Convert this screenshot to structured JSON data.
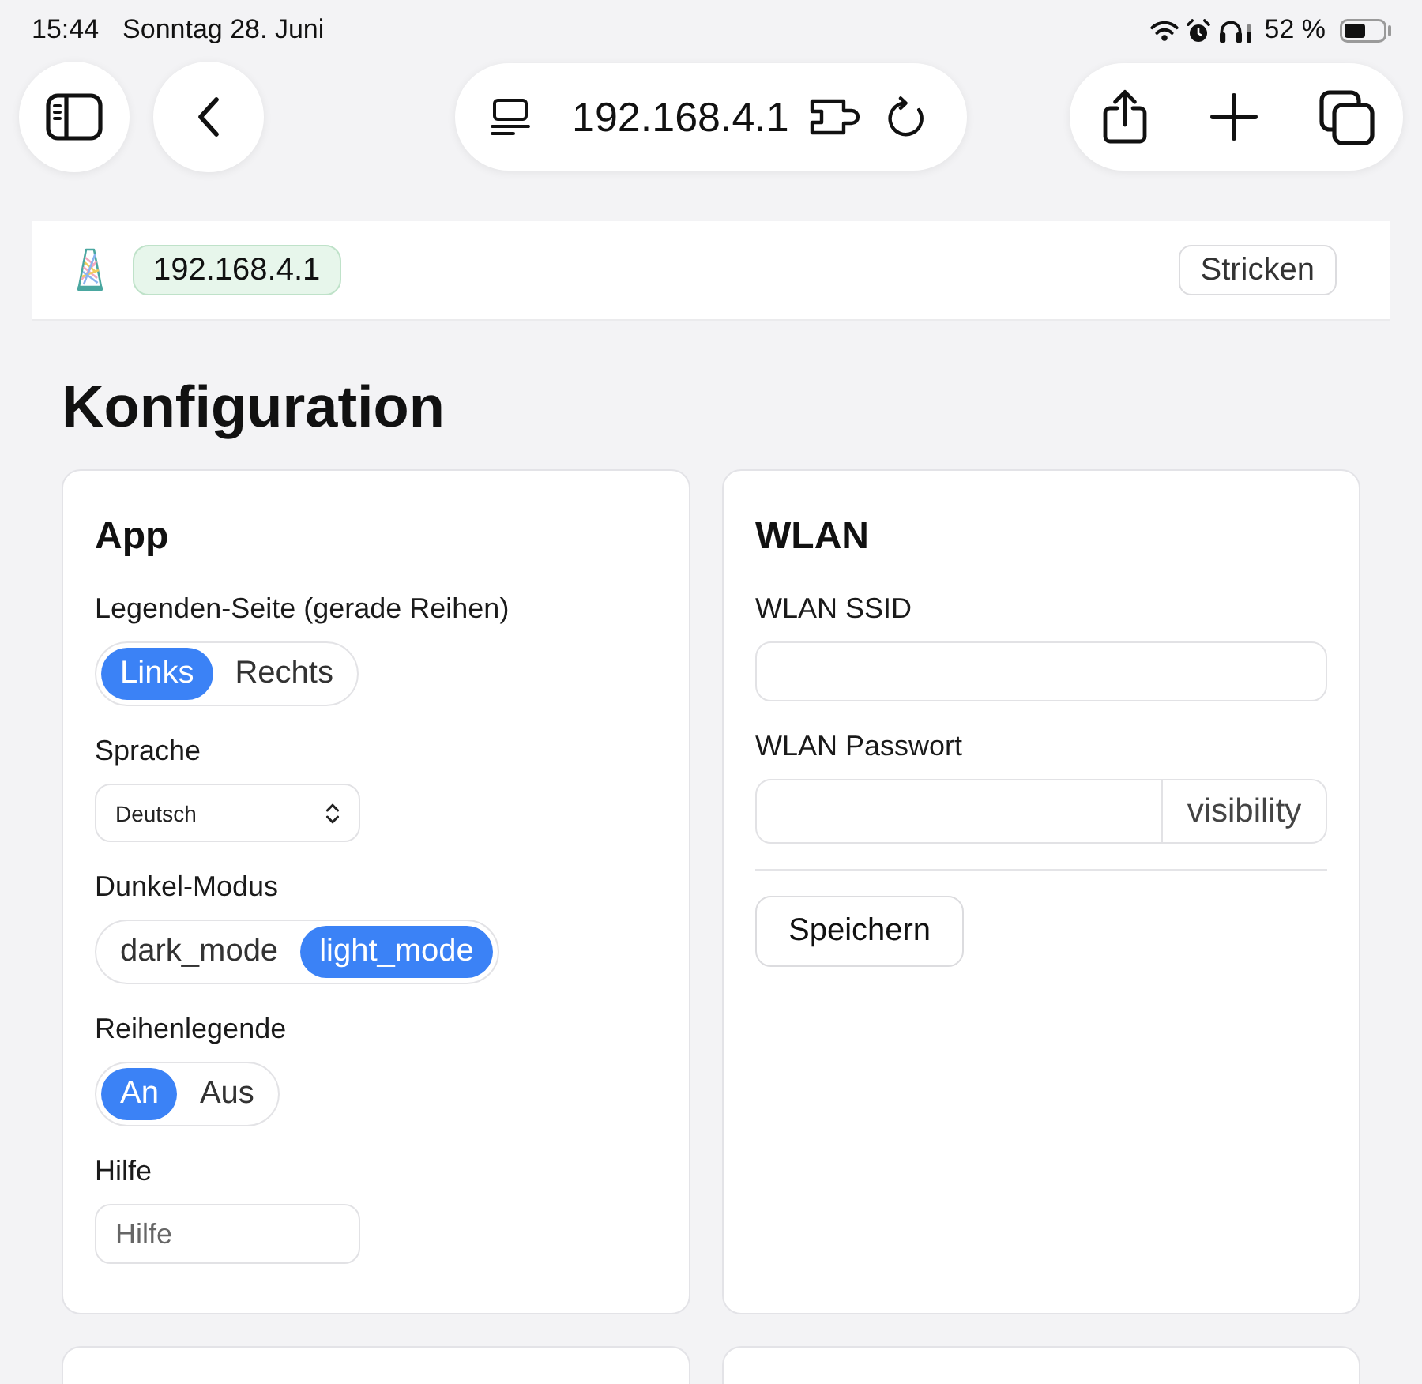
{
  "status_bar": {
    "time": "15:44",
    "date": "Sonntag 28. Juni",
    "battery": "52 %"
  },
  "browser": {
    "address": "192.168.4.1"
  },
  "app_bar": {
    "host": "192.168.4.1",
    "action": "Stricken"
  },
  "title": "Konfiguration",
  "cards": [
    {
      "kind": "form",
      "title": "App",
      "fields": [
        {
          "kind": "segmented",
          "label": "Legenden-Seite (gerade Reihen)",
          "options": [
            {
              "label": "Links",
              "selected": true
            },
            {
              "label": "Rechts",
              "selected": false
            }
          ]
        },
        {
          "kind": "select",
          "label": "Sprache",
          "value": "Deutsch"
        },
        {
          "kind": "segmented",
          "label": "Dunkel-Modus",
          "options": [
            {
              "label": "dark_mode",
              "selected": false
            },
            {
              "label": "light_mode",
              "selected": true
            }
          ]
        },
        {
          "kind": "segmented",
          "label": "Reihenlegende",
          "options": [
            {
              "label": "An",
              "selected": true
            },
            {
              "label": "Aus",
              "selected": false
            }
          ]
        },
        {
          "kind": "text",
          "label": "Hilfe",
          "placeholder": "Hilfe"
        }
      ]
    },
    {
      "kind": "form",
      "title": "WLAN",
      "fields": [
        {
          "kind": "text",
          "label": "WLAN SSID"
        },
        {
          "kind": "addon",
          "label": "WLAN Passwort",
          "addon": "visibility"
        },
        {
          "kind": "divider"
        },
        {
          "kind": "button",
          "label": "Speichern"
        }
      ]
    },
    {
      "kind": "blank"
    },
    {
      "kind": "blank"
    }
  ]
}
